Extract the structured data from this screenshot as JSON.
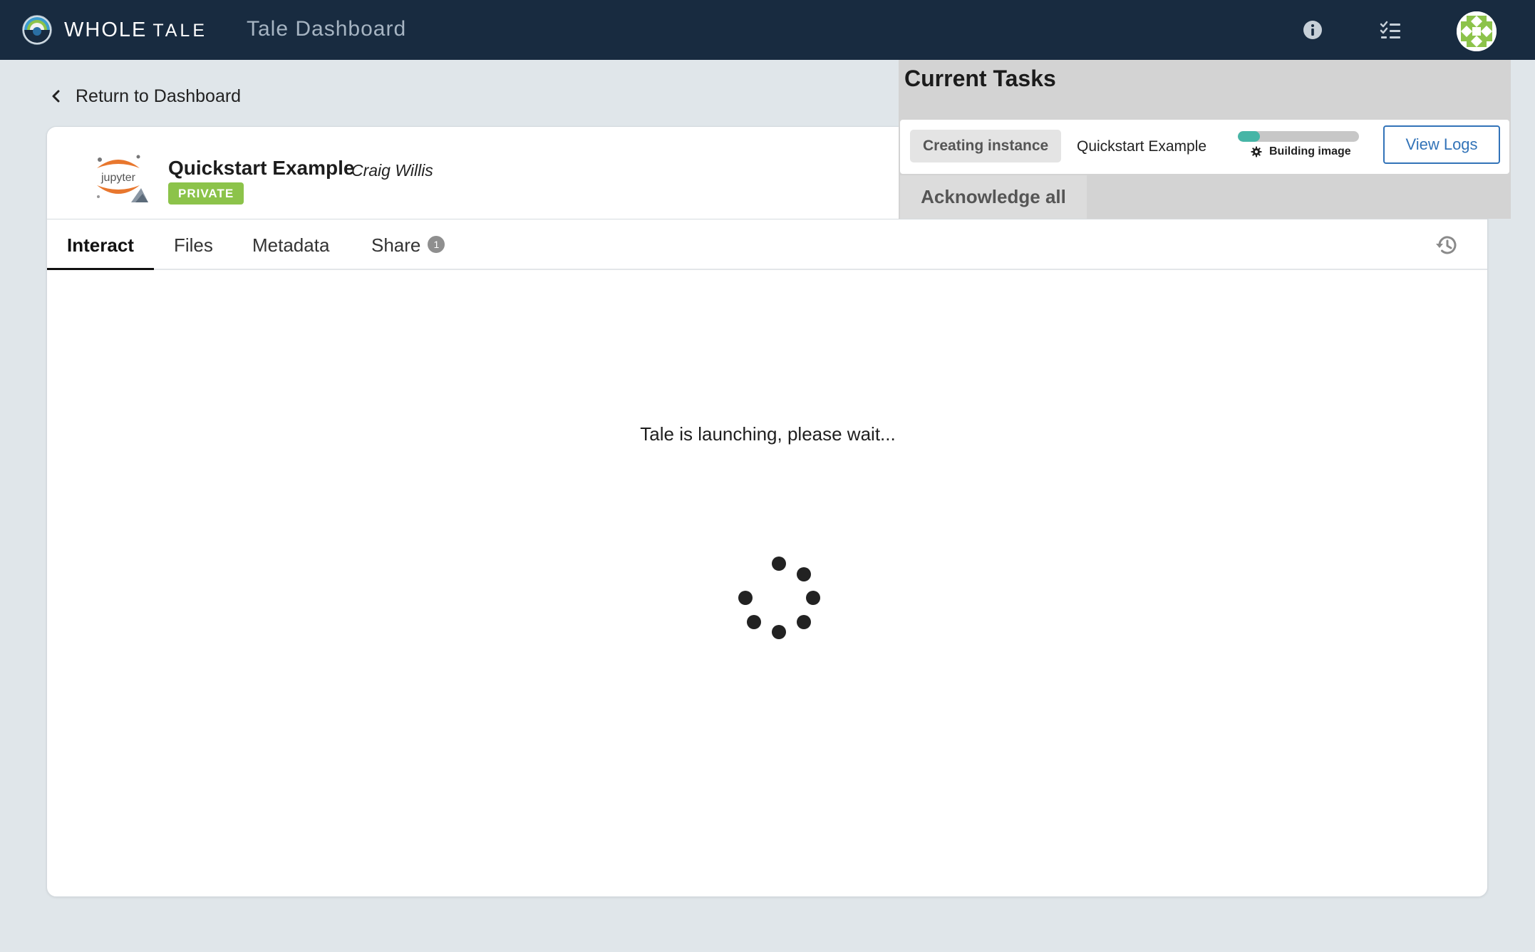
{
  "navbar": {
    "brand_primary": "WHOLE",
    "brand_secondary": "TALE",
    "page_title": "Tale Dashboard",
    "icons": [
      "info-icon",
      "task-list-icon",
      "avatar"
    ]
  },
  "return_link": {
    "label": "Return to Dashboard",
    "icon": "chevron-left-icon"
  },
  "tale": {
    "title": "Quickstart Example",
    "author": "Craig Willis",
    "visibility": "PRIVATE",
    "thumbnail_text": "jupyter"
  },
  "tabs": [
    {
      "label": "Interact",
      "active": true
    },
    {
      "label": "Files",
      "active": false
    },
    {
      "label": "Metadata",
      "active": false
    },
    {
      "label": "Share",
      "active": false,
      "count": "1"
    }
  ],
  "main": {
    "message": "Tale is launching, please wait..."
  },
  "tasks_panel": {
    "title": "Current Tasks",
    "tasks": [
      {
        "status": "Creating instance",
        "name": "Quickstart Example",
        "progress": 0.18,
        "step": "Building image",
        "action_label": "View Logs"
      }
    ],
    "acknowledge_label": "Acknowledge all"
  },
  "colors": {
    "navbar_bg": "#182b40",
    "page_bg": "#e0e6ea",
    "badge_private": "#8cc34a",
    "progress_fill": "#46b5a6",
    "link_blue": "#3273b8",
    "tasks_panel_bg": "#d3d3d3"
  }
}
